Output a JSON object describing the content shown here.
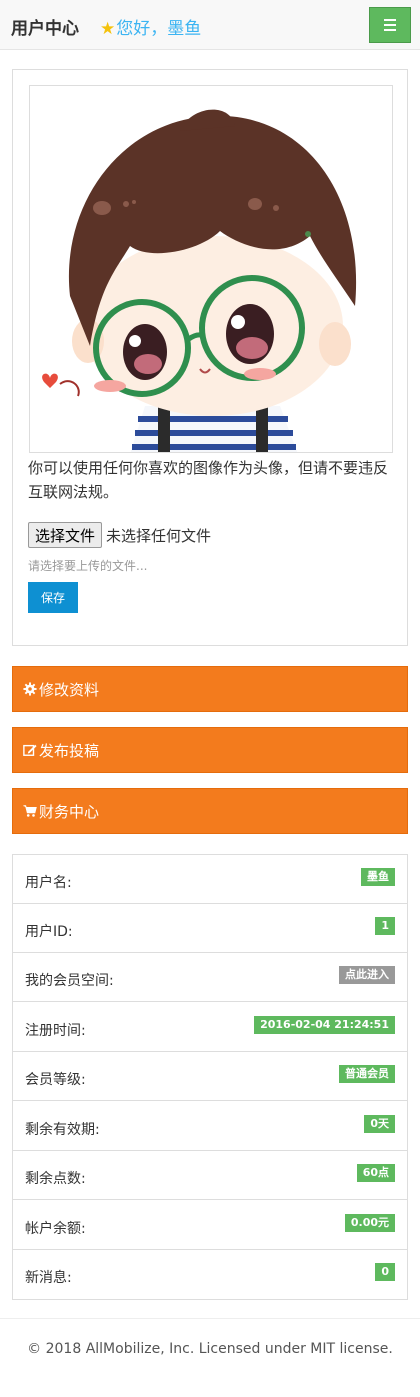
{
  "header": {
    "title": "用户中心",
    "greeting": "您好，",
    "username": "墨鱼",
    "star_icon": "star-icon",
    "menu_icon": "hamburger-icon",
    "accent_color": "#5eb95e"
  },
  "avatar": {
    "note": "你可以使用任何你喜欢的图像作为头像，但请不要违反互联网法规。",
    "file_button": "选择文件",
    "file_status": "未选择任何文件",
    "file_hint": "请选择要上传的文件...",
    "save_label": "保存"
  },
  "nav": [
    {
      "label": "修改资料",
      "icon": "gear-icon"
    },
    {
      "label": "发布投稿",
      "icon": "edit-icon"
    },
    {
      "label": "财务中心",
      "icon": "cart-icon"
    }
  ],
  "info": [
    {
      "label": "用户名:",
      "value": "墨鱼",
      "color": "green"
    },
    {
      "label": "用户ID:",
      "value": "1",
      "color": "green"
    },
    {
      "label": "我的会员空间:",
      "value": "点此进入",
      "color": "gray"
    },
    {
      "label": "注册时间:",
      "value": "2016-02-04 21:24:51",
      "color": "green"
    },
    {
      "label": "会员等级:",
      "value": "普通会员",
      "color": "green"
    },
    {
      "label": "剩余有效期:",
      "value": "0天",
      "color": "green"
    },
    {
      "label": "剩余点数:",
      "value": "60点",
      "color": "green"
    },
    {
      "label": "帐户余额:",
      "value": "0.00元",
      "color": "green"
    },
    {
      "label": "新消息:",
      "value": "0",
      "color": "green"
    }
  ],
  "footer": {
    "text": "© 2018 AllMobilize, Inc. Licensed under MIT license."
  },
  "colors": {
    "orange": "#f37b1d",
    "primary_blue": "#0e90d2",
    "link_blue": "#3bb4f2"
  }
}
